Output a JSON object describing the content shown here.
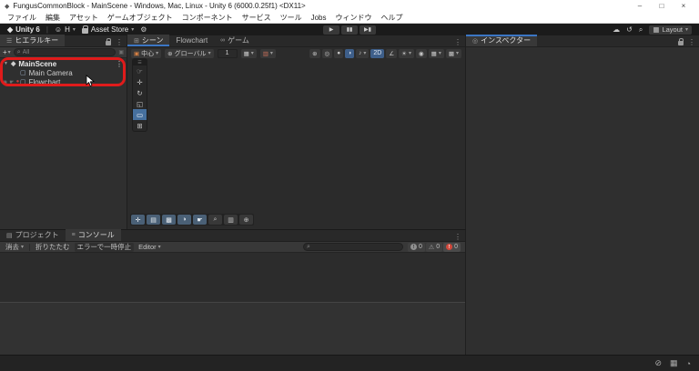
{
  "window": {
    "title": "FungusCommonBlock - MainScene - Windows, Mac, Linux - Unity 6 (6000.0.25f1) <DX11>"
  },
  "menubar": {
    "items": [
      "ファイル",
      "編集",
      "アセット",
      "ゲームオブジェクト",
      "コンポーネント",
      "サービス",
      "ツール",
      "Jobs",
      "ウィンドウ",
      "ヘルプ"
    ]
  },
  "toolbar": {
    "brand": "Unity 6",
    "account": "H",
    "asset_store": "Asset Store",
    "layout": "Layout"
  },
  "hierarchy": {
    "tab": "ヒエラルキー",
    "add": "+",
    "search_placeholder": "All",
    "scene_name": "MainScene",
    "items": [
      "Main Camera",
      "Flowchart"
    ]
  },
  "scene": {
    "tab_scene": "シーン",
    "tab_flowchart": "Flowchart",
    "tab_game": "ゲーム",
    "pivot": "中心",
    "orientation": "グローバル",
    "increment": "1",
    "mode_2d": "2D"
  },
  "bottom": {
    "tab_project": "プロジェクト",
    "tab_console": "コンソール",
    "clear": "消去",
    "collapse": "折りたたむ",
    "error_pause": "エラーで一時停止",
    "editor": "Editor",
    "info_count": "0",
    "warn_count": "0",
    "error_count": "0"
  },
  "inspector": {
    "tab": "インスペクター"
  },
  "colors": {
    "accent_blue": "#3C76C4",
    "selected_blue": "#3E5F8A",
    "annotation_red": "#E01B1B",
    "error_red": "#D3493C",
    "titlebar_white": "#FFFFFF",
    "toolbar_dark": "#1B1B1B",
    "panel_gray": "#383838"
  },
  "icons": {
    "app": "◆",
    "minimize": "–",
    "maximize": "□",
    "close": "×",
    "unity_logo": "◆",
    "dropdown": "▾",
    "account": "☺",
    "gear": "⚙",
    "play": "▶",
    "pause": "▮▮",
    "step": "▶▮",
    "cloud": "☁",
    "history": "↺",
    "search": "⌕",
    "layout_grid": "▦",
    "menu_dots": "⋮",
    "panel_list": "☰",
    "expand": "▼",
    "scene_asset": "◆",
    "cube": "▢",
    "eye": "◉",
    "pick": "☛",
    "red_dot": "●",
    "filter": "▣",
    "plus": "+",
    "scene_tab": "⊞",
    "game_pad": "∞",
    "pivot_box": "▣",
    "globe": "⊕",
    "grid": "▦",
    "magnet": "▥",
    "tool_settings": "⊕",
    "sphere_a": "◎",
    "sphere_b": "●",
    "sphere_c": "◑",
    "note": "♪",
    "ruler": "∠",
    "sun": "☀",
    "eye2": "◉",
    "camera": "▦",
    "gizmo": "▩",
    "handle": "☰",
    "tool_hand": "☞",
    "tool_move": "✛",
    "tool_rotate": "↻",
    "tool_scale": "◱",
    "tool_rect": "▭",
    "tool_transform": "⊞",
    "nav_move": "✛",
    "nav_cam": "▤",
    "nav_grid": "▩",
    "nav_orbit": "◑",
    "nav_hand": "☛",
    "nav_zoom": "⌕",
    "nav_proj": "▥",
    "nav_center": "⊕",
    "folder": "▤",
    "console_lines": "≡",
    "inspector_dot": "◎",
    "excl": "!",
    "warn": "⚠",
    "bell_off": "⊘",
    "package": "▦",
    "progress": "◔"
  }
}
